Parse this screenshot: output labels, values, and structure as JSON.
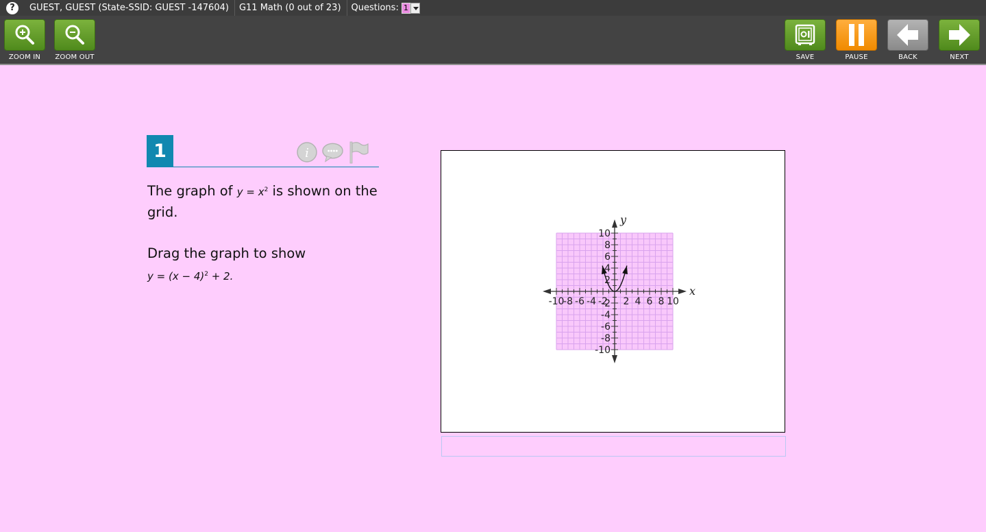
{
  "info_bar": {
    "help_symbol": "?",
    "student": "GUEST, GUEST (State-SSID: GUEST -147604)",
    "test": "G11 Math (0 out of 23)",
    "questions_label": "Questions:",
    "question_selected": "1"
  },
  "toolbar": {
    "zoom_in": "ZOOM IN",
    "zoom_out": "ZOOM OUT",
    "save": "SAVE",
    "pause": "PAUSE",
    "back": "BACK",
    "next": "NEXT"
  },
  "question": {
    "number": "1",
    "stem_line1_pre": "The graph of ",
    "stem_math1_base": "y = x",
    "stem_math1_exp": "2",
    "stem_line1_post": " is shown on the grid.",
    "stem_line2": "Drag the graph to show",
    "stem_math2_base": "y = (x − 4)",
    "stem_math2_exp": "2",
    "stem_math2_tail": " + 2."
  },
  "graph": {
    "x_axis_label": "x",
    "y_axis_label": "y",
    "x_tick_labels": [
      "-10",
      "-8",
      "-6",
      "-4",
      "-2",
      "2",
      "4",
      "6",
      "8",
      "10"
    ],
    "y_tick_labels": [
      "10",
      "8",
      "6",
      "4",
      "2",
      "-2",
      "-4",
      "-6",
      "-8",
      "-10"
    ],
    "x_range": [
      -10,
      10
    ],
    "y_range": [
      -10,
      10
    ],
    "curve": "y = x^2",
    "curve_x_range": [
      -2.1,
      2.1
    ],
    "grid_color": "#d9a3ee",
    "grid_fill": "#f9c8fb"
  },
  "colors": {
    "background": "#fecdfd",
    "accent": "#1188b0",
    "toolbar": "#434343"
  }
}
